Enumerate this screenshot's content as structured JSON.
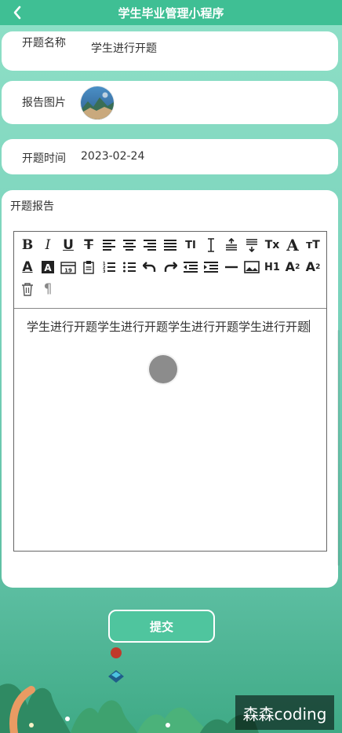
{
  "app": {
    "title": "学生毕业管理小程序"
  },
  "form": {
    "topic_name_label": "开题名称",
    "topic_name_value": "学生进行开题",
    "report_image_label": "报告图片",
    "time_label": "开题时间",
    "time_value": "2023-02-24",
    "report_label": "开题报告",
    "editor_content": "学生进行开题学生进行开题学生进行开题学生进行开题"
  },
  "toolbar": {
    "icons": [
      "bold-icon",
      "italic-icon",
      "underline-icon",
      "strikethrough-icon",
      "align-left-icon",
      "align-center-icon",
      "align-right-icon",
      "align-justify-icon",
      "font-size-icon",
      "line-height-icon",
      "space-before-icon",
      "space-after-icon",
      "clear-format-icon",
      "font-icon",
      "text-size-icon",
      "font-color-icon",
      "background-color-icon",
      "date-icon",
      "clipboard-icon",
      "ordered-list-icon",
      "unordered-list-icon",
      "undo-icon",
      "redo-icon",
      "outdent-icon",
      "indent-icon",
      "divider-icon",
      "image-icon",
      "heading-icon",
      "subscript-icon",
      "superscript-icon",
      "delete-icon",
      "paragraph-icon"
    ]
  },
  "actions": {
    "submit_label": "提交"
  },
  "watermark": {
    "text": "森森coding"
  },
  "colors": {
    "header": "#3fbf94",
    "background_top": "#8fe0c7",
    "background_bottom": "#3faa86",
    "accent": "#4fc59e"
  }
}
